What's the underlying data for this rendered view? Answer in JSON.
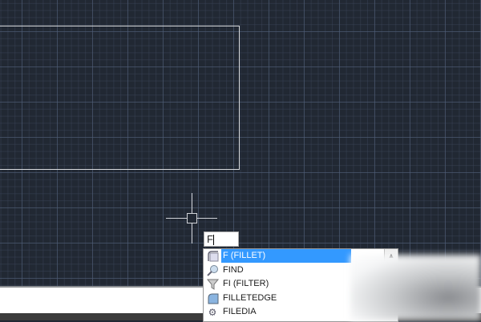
{
  "command_input": {
    "value": "F"
  },
  "autocomplete": {
    "items": [
      {
        "label": "F (FILLET)",
        "icon": "fillet-icon",
        "selected": true
      },
      {
        "label": "FIND",
        "icon": "find-icon",
        "selected": false
      },
      {
        "label": "FI (FILTER)",
        "icon": "filter-icon",
        "selected": false
      },
      {
        "label": "FILLETEDGE",
        "icon": "filletedge-icon",
        "selected": false
      },
      {
        "label": "FILEDIA",
        "icon": "gear-icon",
        "selected": false
      }
    ],
    "highlight_color": "#3399ff"
  },
  "colors": {
    "canvas_bg": "#212833"
  }
}
